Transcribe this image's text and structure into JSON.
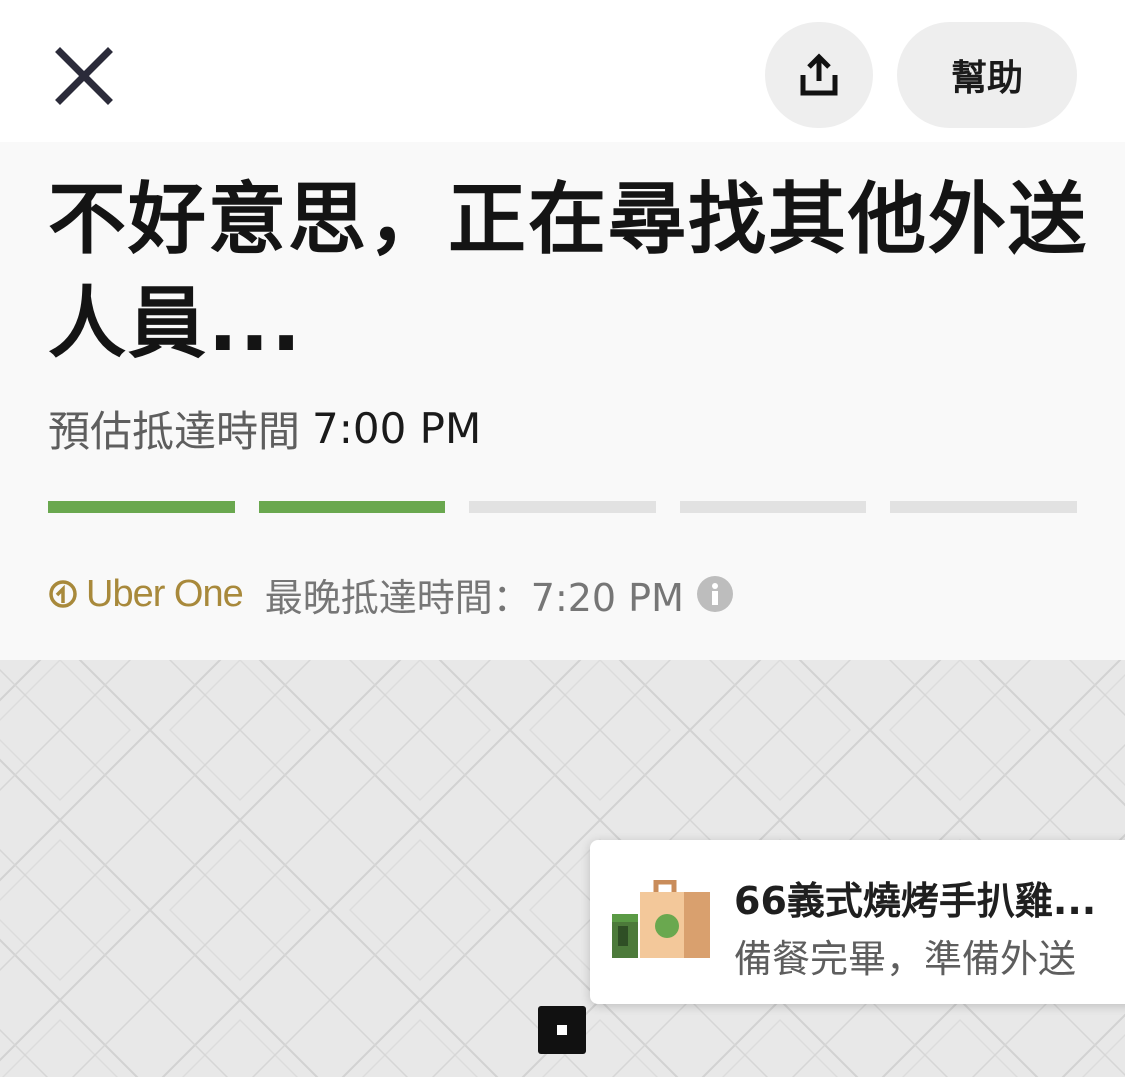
{
  "header": {
    "close_icon": "close-icon",
    "share_icon": "share-icon",
    "help_label": "幫助"
  },
  "status": {
    "headline": "不好意思，正在尋找其他外送人員...",
    "eta_label": "預估抵達時間",
    "eta_time": "7:00 PM",
    "progress": {
      "filled_steps": 2,
      "total_steps": 5
    },
    "progress_color": "#6aa84f",
    "uber_one": {
      "brand": "Uber One",
      "latest_label": "最晚抵達時間：",
      "latest_time": "7:20 PM",
      "brand_color": "#a8893b"
    }
  },
  "map": {
    "restaurant_card": {
      "title": "66義式燒烤手扒雞...",
      "subtitle": "備餐完畢，準備外送",
      "icon": "shopping-bag-icon"
    },
    "marker_icon": "location-marker-icon"
  }
}
